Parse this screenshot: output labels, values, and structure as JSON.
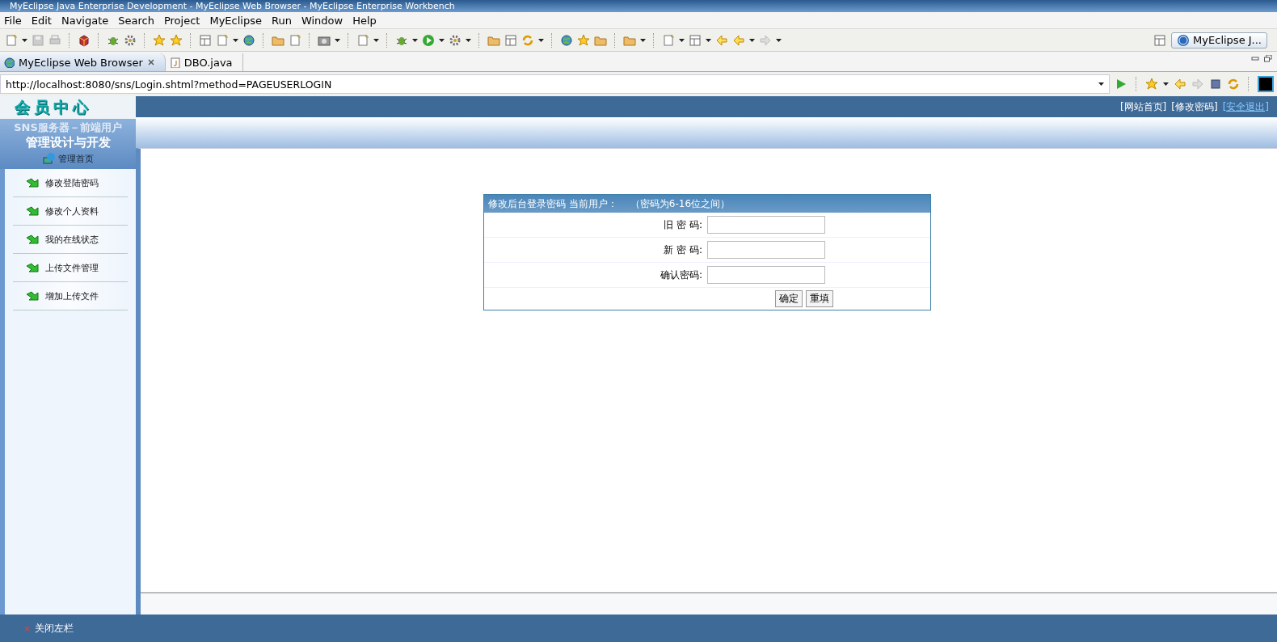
{
  "window": {
    "title": "MyEclipse Java Enterprise Development - MyEclipse Web Browser - MyEclipse Enterprise Workbench"
  },
  "menu": [
    "File",
    "Edit",
    "Navigate",
    "Search",
    "Project",
    "MyEclipse",
    "Run",
    "Window",
    "Help"
  ],
  "perspective": {
    "label": "MyEclipse J..."
  },
  "editor_tabs": [
    {
      "label": "MyEclipse Web Browser",
      "selected": true
    },
    {
      "label": "DBO.java",
      "selected": false
    }
  ],
  "browser": {
    "url": "http://localhost:8080/sns/Login.shtml?method=PAGEUSERLOGIN"
  },
  "page": {
    "header_links": [
      {
        "label": "[网站首页]",
        "hovered": false
      },
      {
        "label": "[修改密码]",
        "hovered": false
      },
      {
        "label": "[安全退出]",
        "hovered": true
      }
    ],
    "sidebar": {
      "logo": "会员中心",
      "subtitle": "SNS服务器－前端用户",
      "subtitle_2": "管理设计与开发",
      "home": "管理首页",
      "items": [
        "修改登陆密码",
        "修改个人资料",
        "我的在线状态",
        "上传文件管理",
        "增加上传文件"
      ]
    },
    "form": {
      "title": "修改后台登录密码 当前用户：",
      "note": "（密码为6-16位之间）",
      "fields": [
        {
          "label": "旧 密 码:"
        },
        {
          "label": "新 密 码:"
        },
        {
          "label": "确认密码:"
        }
      ],
      "buttons": [
        "确定",
        "重填"
      ]
    },
    "footer": {
      "close_sidebar": "关闭左栏"
    }
  }
}
